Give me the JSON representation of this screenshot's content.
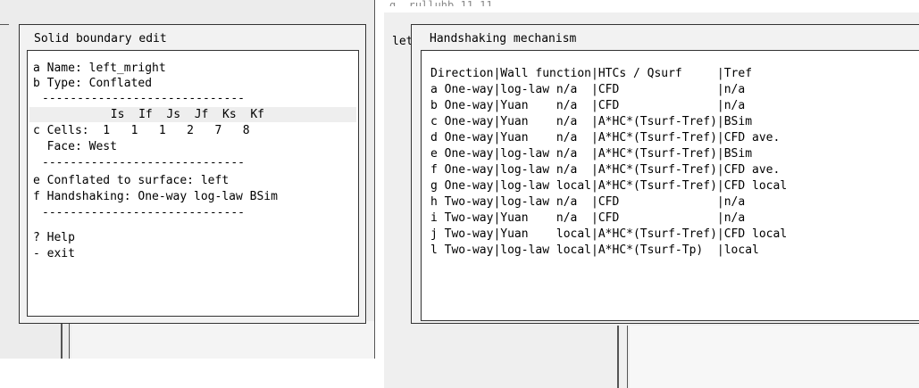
{
  "background": {
    "right_title_fragment": "g. rulluhb 11.11.",
    "left_label_fragment": "let"
  },
  "solid_boundary": {
    "title": "Solid boundary edit",
    "name_line": "a Name: left_mright",
    "type_line": "b Type: Conflated",
    "separator": "-----------------------------",
    "cells_header": "       Is  If  Js  Jf  Ks  Kf",
    "cells_line": "c Cells:  1   1   1   2   7   8",
    "face_line": "  Face: West",
    "conflated_line": "e Conflated to surface: left",
    "handshaking_line": "f Handshaking: One-way log-law BSim",
    "help_line": "? Help",
    "exit_line": "- exit"
  },
  "handshaking": {
    "title": "Handshaking mechanism",
    "header": "Direction|Wall function|HTCs / Qsurf     |Tref",
    "options": [
      {
        "label": "a One-way|log-law n/a  |CFD              |n/a"
      },
      {
        "label": "b One-way|Yuan    n/a  |CFD              |n/a"
      },
      {
        "label": "c One-way|Yuan    n/a  |A*HC*(Tsurf-Tref)|BSim"
      },
      {
        "label": "d One-way|Yuan    n/a  |A*HC*(Tsurf-Tref)|CFD ave."
      },
      {
        "label": "e One-way|log-law n/a  |A*HC*(Tsurf-Tref)|BSim"
      },
      {
        "label": "f One-way|log-law n/a  |A*HC*(Tsurf-Tref)|CFD ave."
      },
      {
        "label": "g One-way|log-law local|A*HC*(Tsurf-Tref)|CFD local"
      },
      {
        "label": "h Two-way|log-law n/a  |CFD              |n/a"
      },
      {
        "label": "i Two-way|Yuan    n/a  |CFD              |n/a"
      },
      {
        "label": "j Two-way|Yuan    local|A*HC*(Tsurf-Tref)|CFD local"
      },
      {
        "label": "l Two-way|log-law local|A*HC*(Tsurf-Tp)  |local"
      }
    ]
  }
}
